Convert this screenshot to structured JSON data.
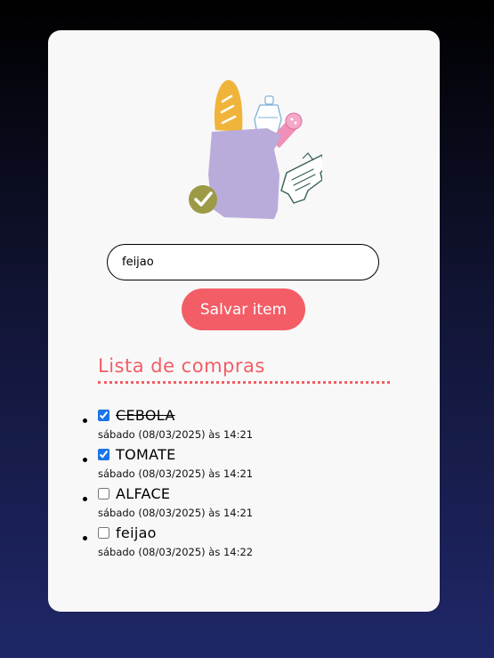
{
  "form": {
    "input_value": "feijao",
    "save_label": "Salvar item"
  },
  "list": {
    "title": "Lista de compras",
    "items": [
      {
        "name": "CEBOLA",
        "checked": true,
        "strikethrough": true,
        "date": "sábado (08/03/2025) às 14:21"
      },
      {
        "name": "TOMATE",
        "checked": true,
        "strikethrough": false,
        "date": "sábado (08/03/2025) às 14:21"
      },
      {
        "name": "ALFACE",
        "checked": false,
        "strikethrough": false,
        "date": "sábado (08/03/2025) às 14:21"
      },
      {
        "name": "feijao",
        "checked": false,
        "strikethrough": false,
        "date": "sábado (08/03/2025) às 14:22"
      }
    ]
  },
  "colors": {
    "accent": "#f35d66",
    "card": "#f8f8f8",
    "bag": "#b9acdb",
    "bread": "#f0b43a",
    "check_badge": "#9c9a46"
  },
  "icons": {
    "hero": "grocery-bag-illustration",
    "badge": "check-badge-icon"
  }
}
